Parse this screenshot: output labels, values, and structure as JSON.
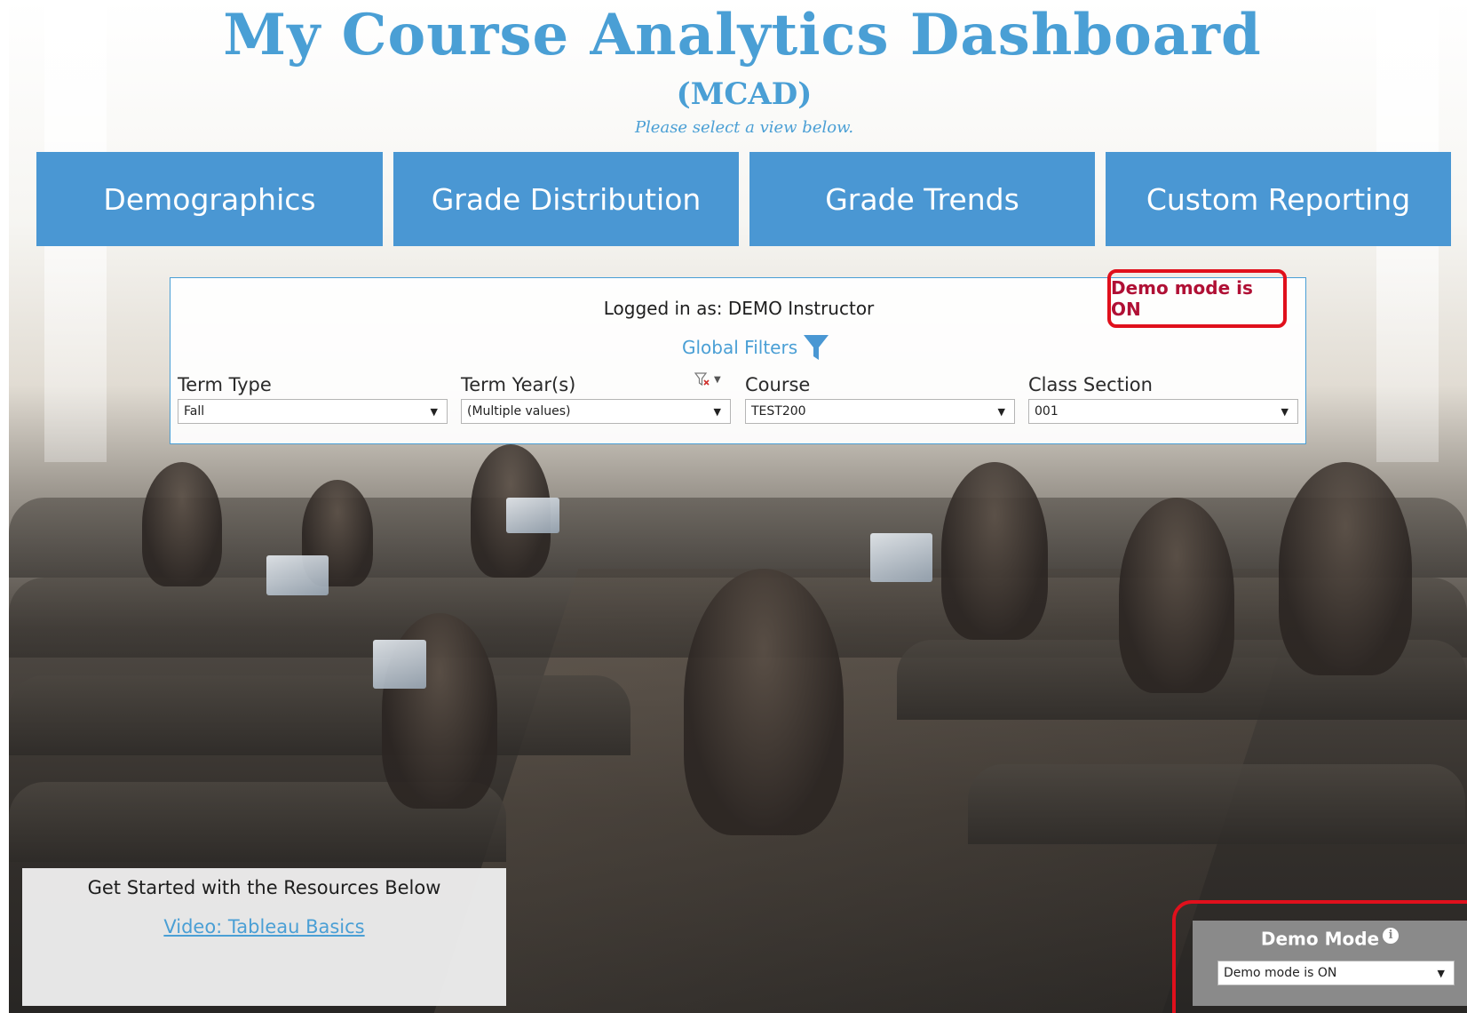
{
  "header": {
    "title": "My Course Analytics Dashboard",
    "subtitle": "(MCAD)",
    "instruction": "Please select a view below."
  },
  "nav": {
    "tiles": [
      {
        "label": "Demographics"
      },
      {
        "label": "Grade Distribution"
      },
      {
        "label": "Grade Trends"
      },
      {
        "label": "Custom Reporting"
      }
    ]
  },
  "filter_panel": {
    "logged_in": "Logged in as: DEMO Instructor",
    "demo_status": "Demo mode is ON",
    "global_filters_label": "Global Filters",
    "filters": [
      {
        "label": "Term Type",
        "value": "Fall"
      },
      {
        "label": "Term Year(s)",
        "value": "(Multiple values)"
      },
      {
        "label": "Course",
        "value": "TEST200"
      },
      {
        "label": "Class Section",
        "value": "001"
      }
    ]
  },
  "resources": {
    "heading": "Get Started with the Resources Below",
    "link_label": "Video: Tableau Basics"
  },
  "demo_mode": {
    "title": "Demo Mode",
    "value": "Demo mode is ON"
  },
  "colors": {
    "brand_blue": "#4a97d3",
    "alert_red": "#e0101c",
    "demo_text": "#b01035"
  },
  "icons": {
    "filter": "funnel-icon",
    "clear_filter": "clear-filter-icon",
    "info": "info-icon",
    "dropdown": "chevron-down-icon"
  }
}
